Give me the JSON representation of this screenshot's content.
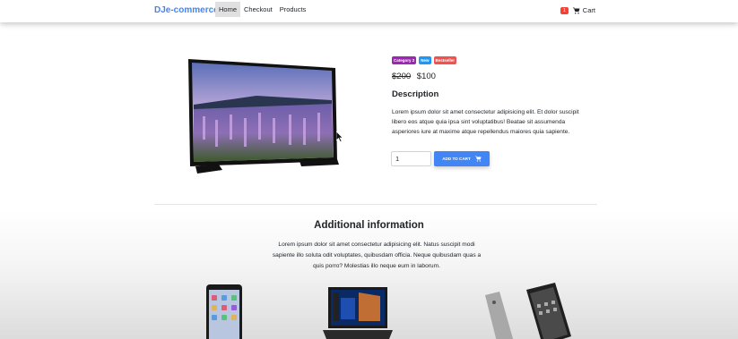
{
  "navbar": {
    "brand": "DJe-commerce",
    "links": [
      {
        "label": "Home",
        "active": true
      },
      {
        "label": "Checkout",
        "active": false
      },
      {
        "label": "Products",
        "active": false
      }
    ],
    "cart_count": "1",
    "cart_label": "Cart"
  },
  "product": {
    "badges": [
      "Category 2",
      "New",
      "Bestseller"
    ],
    "old_price": "$200",
    "price": "$100",
    "description_title": "Description",
    "description": "Lorem ipsum dolor sit amet consectetur adipisicing elit. Et dolor suscipit libero eos atque quia ipsa sint voluptatibus! Beatae sit assumenda asperiores iure at maxime atque repellendus maiores quia sapiente.",
    "quantity": "1",
    "add_to_cart_label": "ADD TO CART"
  },
  "additional": {
    "title": "Additional information",
    "text": "Lorem ipsum dolor sit amet consectetur adipisicing elit. Natus suscipit modi sapiente illo soluta odit voluptates, quibusdam officia. Neque quibusdam quas a quis porro? Molestias illo neque eum in laborum."
  },
  "colors": {
    "brand": "#4285f4",
    "badge_purple": "#9c27b0",
    "badge_blue": "#2196f3",
    "badge_orange": "#ef5350",
    "cart_badge": "#f44336"
  },
  "icons": [
    "shopping-cart-icon",
    "mouse-cursor-icon"
  ]
}
